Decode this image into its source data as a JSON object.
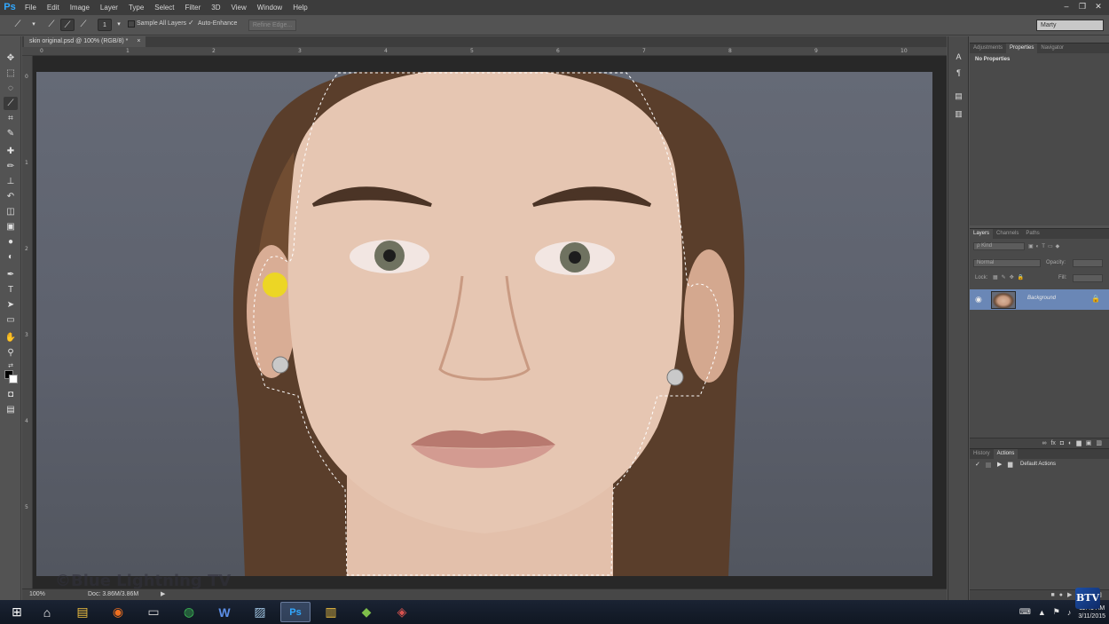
{
  "app": {
    "logo": "Ps",
    "menu": [
      "File",
      "Edit",
      "Image",
      "Layer",
      "Type",
      "Select",
      "Filter",
      "3D",
      "View",
      "Window",
      "Help"
    ],
    "window_controls": [
      "minimize-icon",
      "restore-icon",
      "close-icon"
    ],
    "window_glyphs": [
      "–",
      "❐",
      "✕"
    ]
  },
  "options": {
    "brush_size": "1",
    "sample_all_layers": "Sample All Layers",
    "auto_enhance": "Auto-Enhance",
    "auto_enhance_checked": true,
    "refine_edge": "Refine Edge...",
    "workspace": "Marty"
  },
  "document": {
    "tab_title": "skin original.psd @ 100% (RGB/8) *",
    "tab_close": "×",
    "ruler_h": [
      "0",
      "1",
      "2",
      "3",
      "4",
      "5",
      "6",
      "7",
      "8",
      "9",
      "10"
    ],
    "ruler_v": [
      "0",
      "1",
      "2",
      "3",
      "4",
      "5"
    ],
    "zoom": "100%",
    "doc_info": "Doc: 3.86M/3.86M",
    "watermark": "©Blue Lightning TV"
  },
  "panels": {
    "properties_tabs": [
      "Adjustments",
      "Properties",
      "Navigator"
    ],
    "properties_active": 1,
    "properties_empty": "No Properties",
    "layers_tabs": [
      "Layers",
      "Channels",
      "Paths"
    ],
    "layers_active": 0,
    "kind_filter": "ρ Kind",
    "blend_mode": "Normal",
    "opacity_label": "Opacity:",
    "lock_label": "Lock:",
    "fill_label": "Fill:",
    "layer_name": "Background",
    "history_tabs": [
      "History",
      "Actions"
    ],
    "history_active": 1,
    "action_set": "Default Actions"
  },
  "taskbar": {
    "apps": [
      "windows-start-icon",
      "home-icon",
      "file-explorer-icon",
      "firefox-icon",
      "scanner-icon",
      "chrome-icon",
      "word-icon",
      "image-viewer-icon",
      "photoshop-icon",
      "folder-icon",
      "app-icon",
      "app-icon-2"
    ],
    "app_glyphs": [
      "⊞",
      "⌂",
      "▤",
      "◉",
      "▭",
      "◍",
      "W",
      "▨",
      "Ps",
      "▥",
      "◆",
      "◈"
    ],
    "active_app": 8,
    "clock_time": "11:49 AM",
    "clock_date": "3/11/2015",
    "brand": "BTV"
  }
}
